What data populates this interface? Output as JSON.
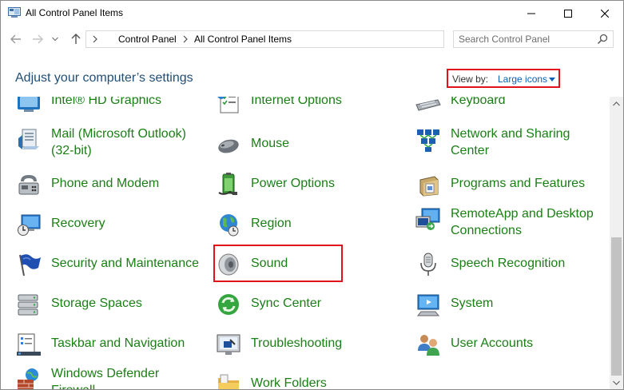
{
  "window": {
    "title": "All Control Panel Items"
  },
  "address": {
    "crumbs": [
      "Control Panel",
      "All Control Panel Items"
    ]
  },
  "search": {
    "placeholder": "Search Control Panel"
  },
  "header": {
    "title": "Adjust your computer’s settings",
    "view_by_label": "View by:",
    "view_by_value": "Large icons"
  },
  "items": {
    "c1": [
      {
        "label": "Intel® HD Graphics",
        "icon": "intel-graphics-icon"
      },
      {
        "label": "Mail (Microsoft Outlook) (32-bit)",
        "icon": "mail-icon"
      },
      {
        "label": "Phone and Modem",
        "icon": "phone-modem-icon"
      },
      {
        "label": "Recovery",
        "icon": "recovery-icon"
      },
      {
        "label": "Security and Maintenance",
        "icon": "flag-icon"
      },
      {
        "label": "Storage Spaces",
        "icon": "storage-spaces-icon"
      },
      {
        "label": "Taskbar and Navigation",
        "icon": "taskbar-icon"
      },
      {
        "label": "Windows Defender Firewall",
        "icon": "firewall-icon"
      }
    ],
    "c2": [
      {
        "label": "Internet Options",
        "icon": "internet-options-icon"
      },
      {
        "label": "Mouse",
        "icon": "mouse-icon"
      },
      {
        "label": "Power Options",
        "icon": "power-options-icon"
      },
      {
        "label": "Region",
        "icon": "globe-icon"
      },
      {
        "label": "Sound",
        "icon": "speaker-icon"
      },
      {
        "label": "Sync Center",
        "icon": "sync-icon"
      },
      {
        "label": "Troubleshooting",
        "icon": "troubleshooting-icon"
      },
      {
        "label": "Work Folders",
        "icon": "folder-icon"
      }
    ],
    "c3": [
      {
        "label": "Keyboard",
        "icon": "keyboard-icon"
      },
      {
        "label": "Network and Sharing Center",
        "icon": "network-icon"
      },
      {
        "label": "Programs and Features",
        "icon": "programs-icon"
      },
      {
        "label": "RemoteApp and Desktop Connections",
        "icon": "remoteapp-icon"
      },
      {
        "label": "Speech Recognition",
        "icon": "microphone-icon"
      },
      {
        "label": "System",
        "icon": "system-icon"
      },
      {
        "label": "User Accounts",
        "icon": "user-accounts-icon"
      }
    ]
  },
  "colors": {
    "link_green": "#1a7f14",
    "heading_blue": "#1e4e79",
    "accent_blue": "#0b5fb7",
    "highlight_red": "#e0121c"
  }
}
